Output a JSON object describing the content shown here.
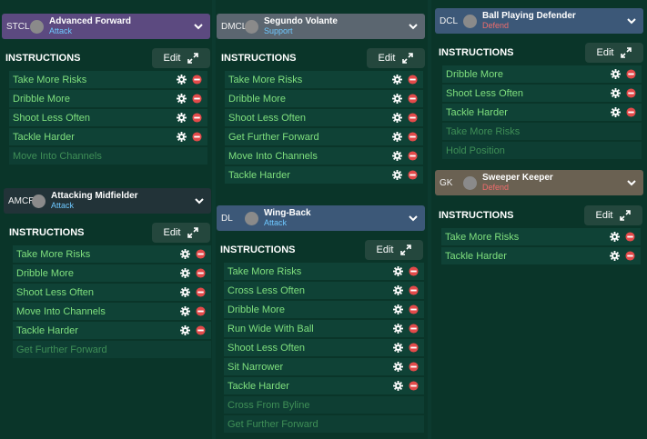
{
  "colors": {
    "attack": "#6ec8ff",
    "support": "#6ec8ff",
    "defend": "#ef6c6c",
    "active_instruction": "#7fe07e",
    "inactive_instruction": "#3f8f57",
    "remove": "#e34a4a"
  },
  "instructions_label": "INSTRUCTIONS",
  "edit_label": "Edit",
  "cards": [
    {
      "position": "STCL",
      "role": "Advanced Forward",
      "duty": "Attack",
      "header_color": "#5c4a80",
      "instructions": [
        {
          "label": "Take More Risks",
          "active": true
        },
        {
          "label": "Dribble More",
          "active": true
        },
        {
          "label": "Shoot Less Often",
          "active": true
        },
        {
          "label": "Tackle Harder",
          "active": true
        },
        {
          "label": "Move Into Channels",
          "active": false
        }
      ]
    },
    {
      "position": "AMCR",
      "role": "Attacking Midfielder",
      "duty": "Attack",
      "header_color": "#223338",
      "instructions": [
        {
          "label": "Take More Risks",
          "active": true
        },
        {
          "label": "Dribble More",
          "active": true
        },
        {
          "label": "Shoot Less Often",
          "active": true
        },
        {
          "label": "Move Into Channels",
          "active": true
        },
        {
          "label": "Tackle Harder",
          "active": true
        },
        {
          "label": "Get Further Forward",
          "active": false
        }
      ]
    },
    {
      "position": "DMCL",
      "role": "Segundo Volante",
      "duty": "Support",
      "header_color": "#5b6670",
      "instructions": [
        {
          "label": "Take More Risks",
          "active": true
        },
        {
          "label": "Dribble More",
          "active": true
        },
        {
          "label": "Shoot Less Often",
          "active": true
        },
        {
          "label": "Get Further Forward",
          "active": true
        },
        {
          "label": "Move Into Channels",
          "active": true
        },
        {
          "label": "Tackle Harder",
          "active": true
        }
      ]
    },
    {
      "position": "DL",
      "role": "Wing-Back",
      "duty": "Attack",
      "header_color": "#3c5878",
      "instructions": [
        {
          "label": "Take More Risks",
          "active": true
        },
        {
          "label": "Cross Less Often",
          "active": true
        },
        {
          "label": "Dribble More",
          "active": true
        },
        {
          "label": "Run Wide With Ball",
          "active": true
        },
        {
          "label": "Shoot Less Often",
          "active": true
        },
        {
          "label": "Sit Narrower",
          "active": true
        },
        {
          "label": "Tackle Harder",
          "active": true
        },
        {
          "label": "Cross From Byline",
          "active": false
        },
        {
          "label": "Get Further Forward",
          "active": false
        }
      ]
    },
    {
      "position": "DCL",
      "role": "Ball Playing Defender",
      "duty": "Defend",
      "header_color": "#3c5878",
      "instructions": [
        {
          "label": "Dribble More",
          "active": true
        },
        {
          "label": "Shoot Less Often",
          "active": true
        },
        {
          "label": "Tackle Harder",
          "active": true
        },
        {
          "label": "Take More Risks",
          "active": false
        },
        {
          "label": "Hold Position",
          "active": false
        }
      ]
    },
    {
      "position": "GK",
      "role": "Sweeper Keeper",
      "duty": "Defend",
      "header_color": "#6a6152",
      "instructions": [
        {
          "label": "Take More Risks",
          "active": true
        },
        {
          "label": "Tackle Harder",
          "active": true
        }
      ]
    }
  ]
}
